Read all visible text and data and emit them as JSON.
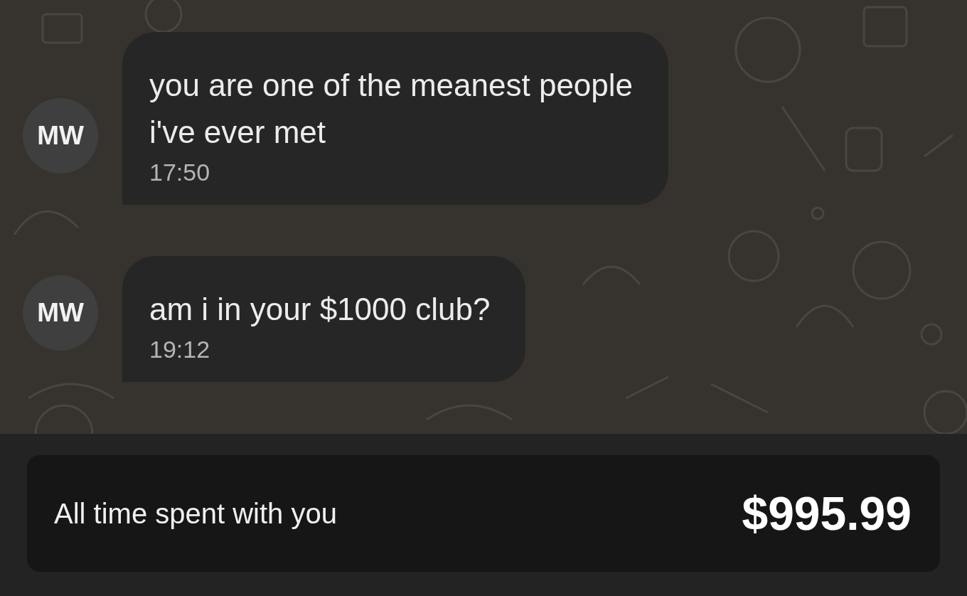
{
  "messages": [
    {
      "avatar": "MW",
      "lines": [
        "you are one of the meanest people",
        "i've ever met"
      ],
      "time": "17:50"
    },
    {
      "avatar": "MW",
      "lines": [
        "am i in your $1000 club?"
      ],
      "time": "19:12"
    }
  ],
  "summary": {
    "label": "All time spent with you",
    "amount": "$995.99"
  }
}
